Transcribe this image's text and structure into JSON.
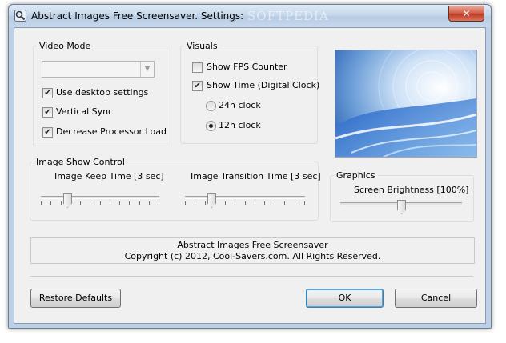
{
  "window": {
    "title": "Abstract Images Free Screensaver. Settings:",
    "watermark": "SOFTPEDIA",
    "close_glyph": "✕",
    "icon": "app-icon"
  },
  "video_mode": {
    "legend": "Video Mode",
    "combo_value": "",
    "options": [
      {
        "label": "Use desktop settings",
        "checked": true
      },
      {
        "label": "Vertical Sync",
        "checked": true
      },
      {
        "label": "Decrease Processor Load",
        "checked": true
      }
    ]
  },
  "visuals": {
    "legend": "Visuals",
    "show_fps": {
      "label": "Show FPS Counter",
      "checked": false
    },
    "show_time": {
      "label": "Show Time (Digital Clock)",
      "checked": true
    },
    "clock_24h": {
      "label": "24h clock",
      "selected": false
    },
    "clock_12h": {
      "label": "12h clock",
      "selected": true
    }
  },
  "image_show_control": {
    "legend": "Image Show Control",
    "keep_time": {
      "label": "Image Keep Time [3 sec]",
      "fraction": 0.2
    },
    "transition_time": {
      "label": "Image Transition Time [3 sec]",
      "fraction": 0.2
    }
  },
  "graphics": {
    "legend": "Graphics",
    "brightness": {
      "label": "Screen Brightness [100%]",
      "fraction": 0.5
    }
  },
  "info": {
    "line1": "Abstract Images Free Screensaver",
    "line2": "Copyright (c) 2012, Cool-Savers.com. All Rights Reserved."
  },
  "buttons": {
    "restore": "Restore Defaults",
    "ok": "OK",
    "cancel": "Cancel"
  },
  "colors": {
    "accent_blue": "#2a6fcf",
    "frame": "#bcd0e6"
  }
}
